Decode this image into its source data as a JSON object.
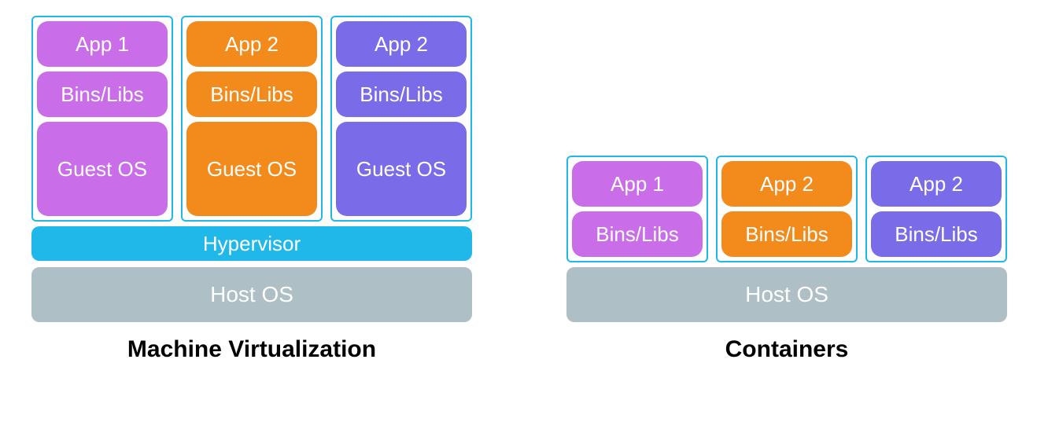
{
  "virtualization": {
    "title": "Machine Virtualization",
    "columns": [
      {
        "color": "purple",
        "app": "App 1",
        "libs": "Bins/Libs",
        "os": "Guest OS"
      },
      {
        "color": "orange",
        "app": "App 2",
        "libs": "Bins/Libs",
        "os": "Guest OS"
      },
      {
        "color": "violet",
        "app": "App 2",
        "libs": "Bins/Libs",
        "os": "Guest OS"
      }
    ],
    "hypervisor": "Hypervisor",
    "host_os": "Host OS"
  },
  "containers": {
    "title": "Containers",
    "columns": [
      {
        "color": "purple",
        "app": "App 1",
        "libs": "Bins/Libs"
      },
      {
        "color": "orange",
        "app": "App 2",
        "libs": "Bins/Libs"
      },
      {
        "color": "violet",
        "app": "App 2",
        "libs": "Bins/Libs"
      }
    ],
    "host_os": "Host OS"
  }
}
